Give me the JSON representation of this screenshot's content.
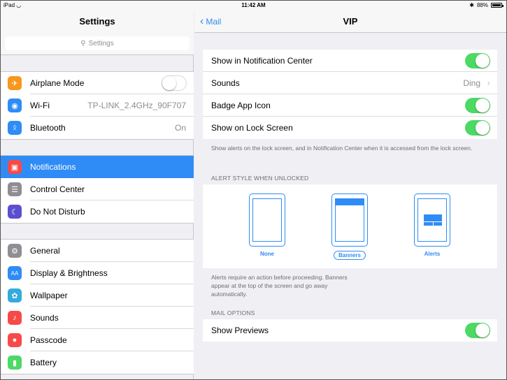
{
  "status": {
    "carrier": "iPad",
    "time": "11:42 AM",
    "battery": "88%",
    "battery_level": 0.88
  },
  "sidebar": {
    "title": "Settings",
    "search_placeholder": "Settings",
    "group1": [
      {
        "label": "Airplane Mode",
        "icon": "airplane-icon",
        "color": "#f7971e",
        "toggle": false
      },
      {
        "label": "Wi-Fi",
        "icon": "wifi-icon",
        "color": "#2f8cf6",
        "value": "TP-LINK_2.4GHz_90F707"
      },
      {
        "label": "Bluetooth",
        "icon": "bluetooth-icon",
        "color": "#2f8cf6",
        "value": "On"
      }
    ],
    "group2": [
      {
        "label": "Notifications",
        "icon": "notifications-icon",
        "color": "#f74a48",
        "selected": true
      },
      {
        "label": "Control Center",
        "icon": "control-center-icon",
        "color": "#8e8e93"
      },
      {
        "label": "Do Not Disturb",
        "icon": "moon-icon",
        "color": "#5b4fcf"
      }
    ],
    "group3": [
      {
        "label": "General",
        "icon": "gear-icon",
        "color": "#8e8e93"
      },
      {
        "label": "Display & Brightness",
        "icon": "display-icon",
        "color": "#2f8cf6"
      },
      {
        "label": "Wallpaper",
        "icon": "wallpaper-icon",
        "color": "#35aadc"
      },
      {
        "label": "Sounds",
        "icon": "sounds-icon",
        "color": "#f74a48"
      },
      {
        "label": "Passcode",
        "icon": "lock-icon",
        "color": "#f74a48"
      },
      {
        "label": "Battery",
        "icon": "battery-icon",
        "color": "#4cd964"
      }
    ]
  },
  "detail": {
    "back_label": "Mail",
    "title": "VIP",
    "rows": [
      {
        "label": "Show in Notification Center",
        "toggle": true
      },
      {
        "label": "Sounds",
        "value": "Ding"
      },
      {
        "label": "Badge App Icon",
        "toggle": true
      },
      {
        "label": "Show on Lock Screen",
        "toggle": true
      }
    ],
    "lock_note": "Show alerts on the lock screen, and in Notification Center when it is accessed from the lock screen.",
    "alert_style_header": "ALERT STYLE WHEN UNLOCKED",
    "alert_styles": {
      "none": "None",
      "banners": "Banners",
      "alerts": "Alerts",
      "selected": "Banners"
    },
    "alert_note": "Alerts require an action before proceeding. Banners appear at the top of the screen and go away automatically.",
    "mail_options_header": "MAIL OPTIONS",
    "show_previews": {
      "label": "Show Previews",
      "toggle": true
    }
  }
}
